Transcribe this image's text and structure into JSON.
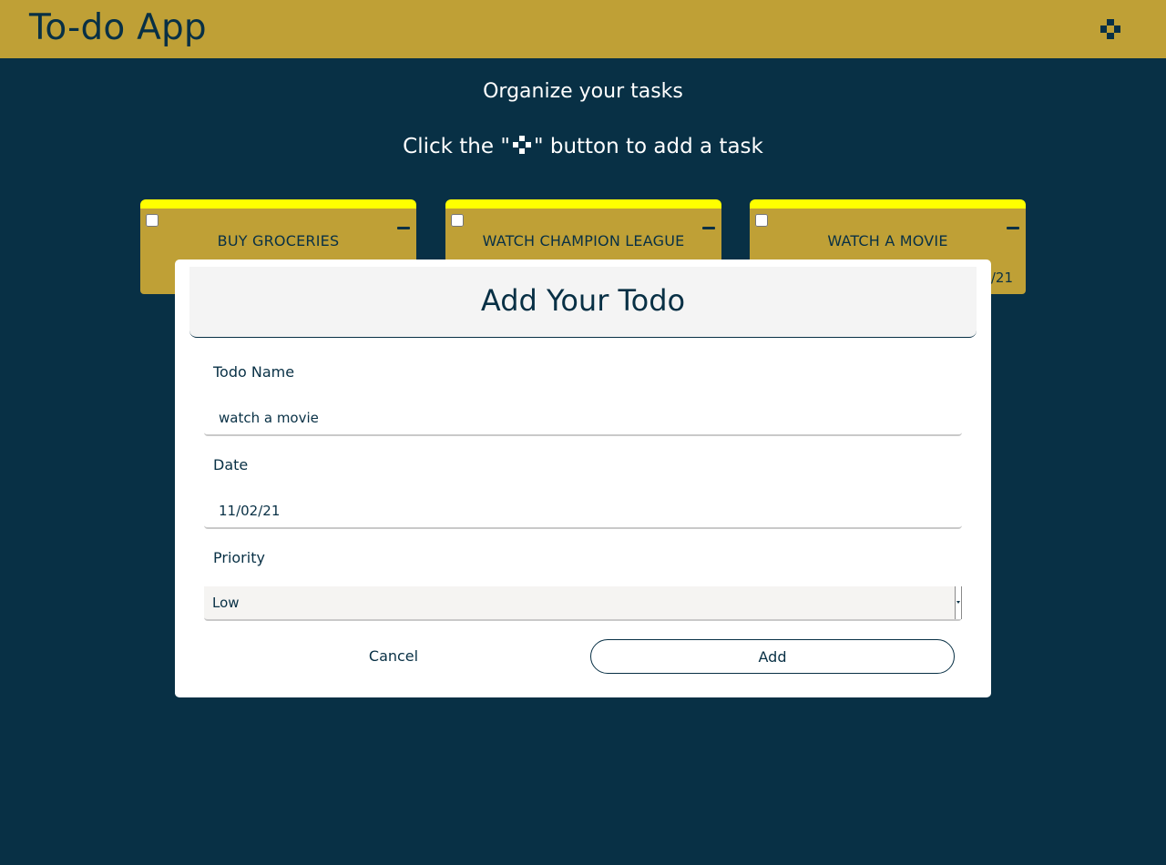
{
  "header": {
    "title": "To-do App",
    "add_icon": "plus-icon"
  },
  "intro": {
    "subtitle": "Organize your tasks",
    "hint_before": "Click the",
    "hint_after": "button to add a task",
    "hint_icon": "plus-icon"
  },
  "cards": [
    {
      "title": "BUY GROCERIES",
      "checked": false,
      "date": ""
    },
    {
      "title": "WATCH CHAMPION LEAGUE",
      "checked": false,
      "date": ""
    },
    {
      "title": "WATCH A MOVIE",
      "checked": false,
      "date": "/21"
    }
  ],
  "modal": {
    "title": "Add Your Todo",
    "name_label": "Todo Name",
    "name_value": "watch a movie",
    "date_label": "Date",
    "date_value": "11/02/21",
    "priority_label": "Priority",
    "priority_value": "Low",
    "cancel_label": "Cancel",
    "add_label": "Add"
  },
  "colors": {
    "background": "#083045",
    "header": "#bfa036",
    "card": "#bfa036",
    "card_top": "#ffff00",
    "text_dark": "#083045"
  }
}
